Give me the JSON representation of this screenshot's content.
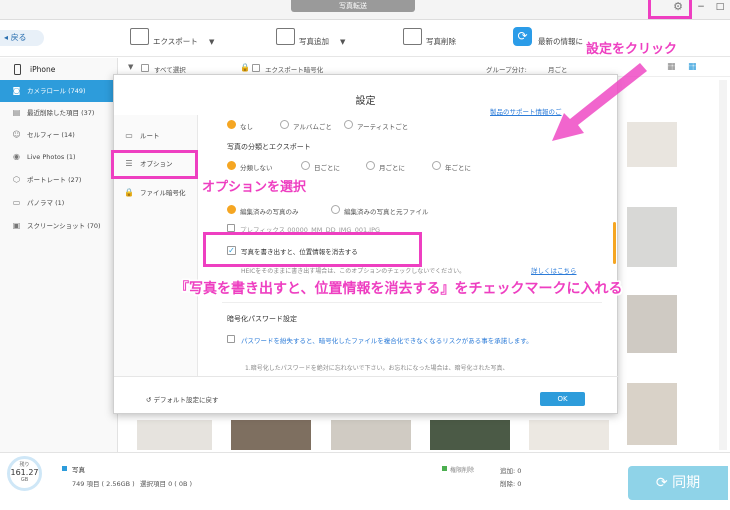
{
  "window": {
    "title": "写真転送"
  },
  "toolbar": {
    "back": "戻る",
    "export": "エクスポート",
    "add_photo": "写真追加",
    "delete_photo": "写真削除",
    "refresh": "最新の情報に"
  },
  "sidebar": {
    "device": "iPhone",
    "items": [
      {
        "label": "カメラロール (749)",
        "icon": "camera-icon"
      },
      {
        "label": "最近削除した項目 (37)",
        "icon": "trash-icon"
      },
      {
        "label": "セルフィー (14)",
        "icon": "person-icon"
      },
      {
        "label": "Live Photos (1)",
        "icon": "live-icon"
      },
      {
        "label": "ポートレート (27)",
        "icon": "cube-icon"
      },
      {
        "label": "パノラマ (1)",
        "icon": "panorama-icon"
      },
      {
        "label": "スクリーンショット (70)",
        "icon": "screenshot-icon"
      }
    ]
  },
  "content_bar": {
    "select_all": "すべて選択",
    "export_encrypt": "エクスポート暗号化",
    "group_by_label": "グループ分け:",
    "group_by_value": "月ごと"
  },
  "dialog": {
    "title": "設定",
    "support_link": "製品のサポート情報のご",
    "nav": [
      {
        "label": "ルート",
        "icon": "folder-icon"
      },
      {
        "label": "オプション",
        "icon": "options-icon"
      },
      {
        "label": "ファイル暗号化",
        "icon": "lock-icon"
      }
    ],
    "album_options": [
      "なし",
      "アルバムごと",
      "アーティストごと"
    ],
    "section_classify": "写真の分類とエクスポート",
    "classify_options": [
      "分類しない",
      "日ごとに",
      "月ごとに",
      "年ごとに"
    ],
    "edit_options": [
      "編集済みの写真のみ",
      "編集済みの写真と元ファイル"
    ],
    "prefix_option": "プレフィックス 00000_MM_DD_IMG_001.JPG",
    "geo_option": "写真を書き出すと、位置情報を消去する",
    "heic_note": "HEICをそのままに書き出す場合は、このオプションのチェックしないでください。",
    "heic_link": "詳しくはこちら",
    "section_password": "暗号化パスワード設定",
    "password_warning": "パスワードを紛失すると、暗号化したファイルを複合化できなくなるリスクがある事を承諾します。",
    "password_note": "1.暗号化したパスワードを絶対に忘れないで下さい。お忘れになった場合は、暗号化された写真、",
    "default_button": "デフォルト設定に戻す",
    "ok_button": "OK"
  },
  "annotations": {
    "settings": "設定をクリック",
    "option": "オプションを選択",
    "main": "『写真を書き出すと、位置情報を消去する』をチェックマークに入れる"
  },
  "bottom": {
    "storage_label": "残り",
    "storage_value": "161.27",
    "storage_unit": "GB",
    "photos_label": "写真",
    "photos_detail": "749 項目 ( 2.56GB )",
    "selected": "選択項目 0 ( 0B )",
    "permission": "権限削除",
    "add_label": "追加: 0",
    "delete_label": "削除: 0",
    "sync": "同期"
  },
  "colors": {
    "accent": "#2d9cdb",
    "annotation": "#ee3fc1",
    "check": "#f5a623"
  }
}
